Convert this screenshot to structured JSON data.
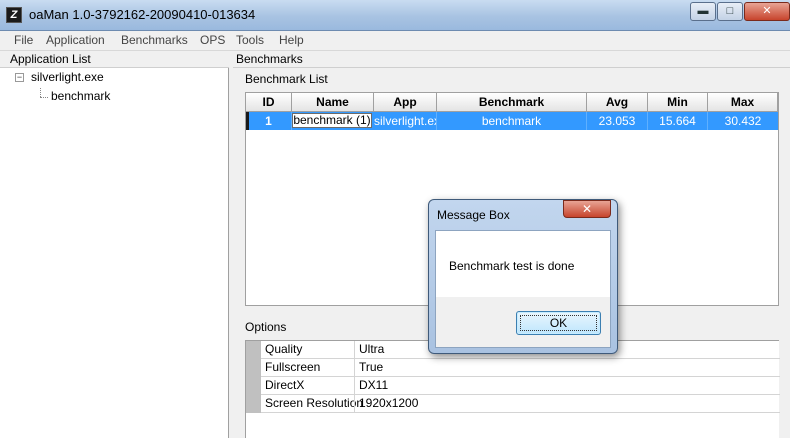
{
  "window": {
    "title": "oaMan 1.0-3792162-20090410-013634",
    "icon": "oa-app-icon",
    "icon_glyph": "Z"
  },
  "caption_buttons": {
    "minimize": "▬",
    "maximize": "□",
    "close": "✕"
  },
  "menu": [
    "File",
    "Application",
    "Benchmarks",
    "OPS",
    "Tools",
    "Help"
  ],
  "left_pane": {
    "header": "Application List",
    "tree": {
      "expander": "−",
      "root": "silverlight.exe",
      "child": "benchmark"
    }
  },
  "right_pane": {
    "header": "Benchmarks",
    "benchmark_list": {
      "label": "Benchmark List",
      "columns": [
        "ID",
        "Name",
        "App",
        "Benchmark",
        "Avg",
        "Min",
        "Max"
      ],
      "rows": [
        {
          "id": "1",
          "name": "benchmark (1)",
          "app": "silverlight.exe",
          "benchmark": "benchmark",
          "avg": "23.053",
          "min": "15.664",
          "max": "30.432"
        }
      ]
    },
    "options": {
      "label": "Options",
      "rows": [
        {
          "name": "Quality",
          "value": "Ultra"
        },
        {
          "name": "Fullscreen",
          "value": "True"
        },
        {
          "name": "DirectX",
          "value": "DX11"
        },
        {
          "name": "Screen Resolution",
          "value": "1920x1200"
        }
      ]
    }
  },
  "message_box": {
    "title": "Message Box",
    "close_glyph": "✕",
    "message": "Benchmark test is done",
    "ok_label": "OK"
  }
}
